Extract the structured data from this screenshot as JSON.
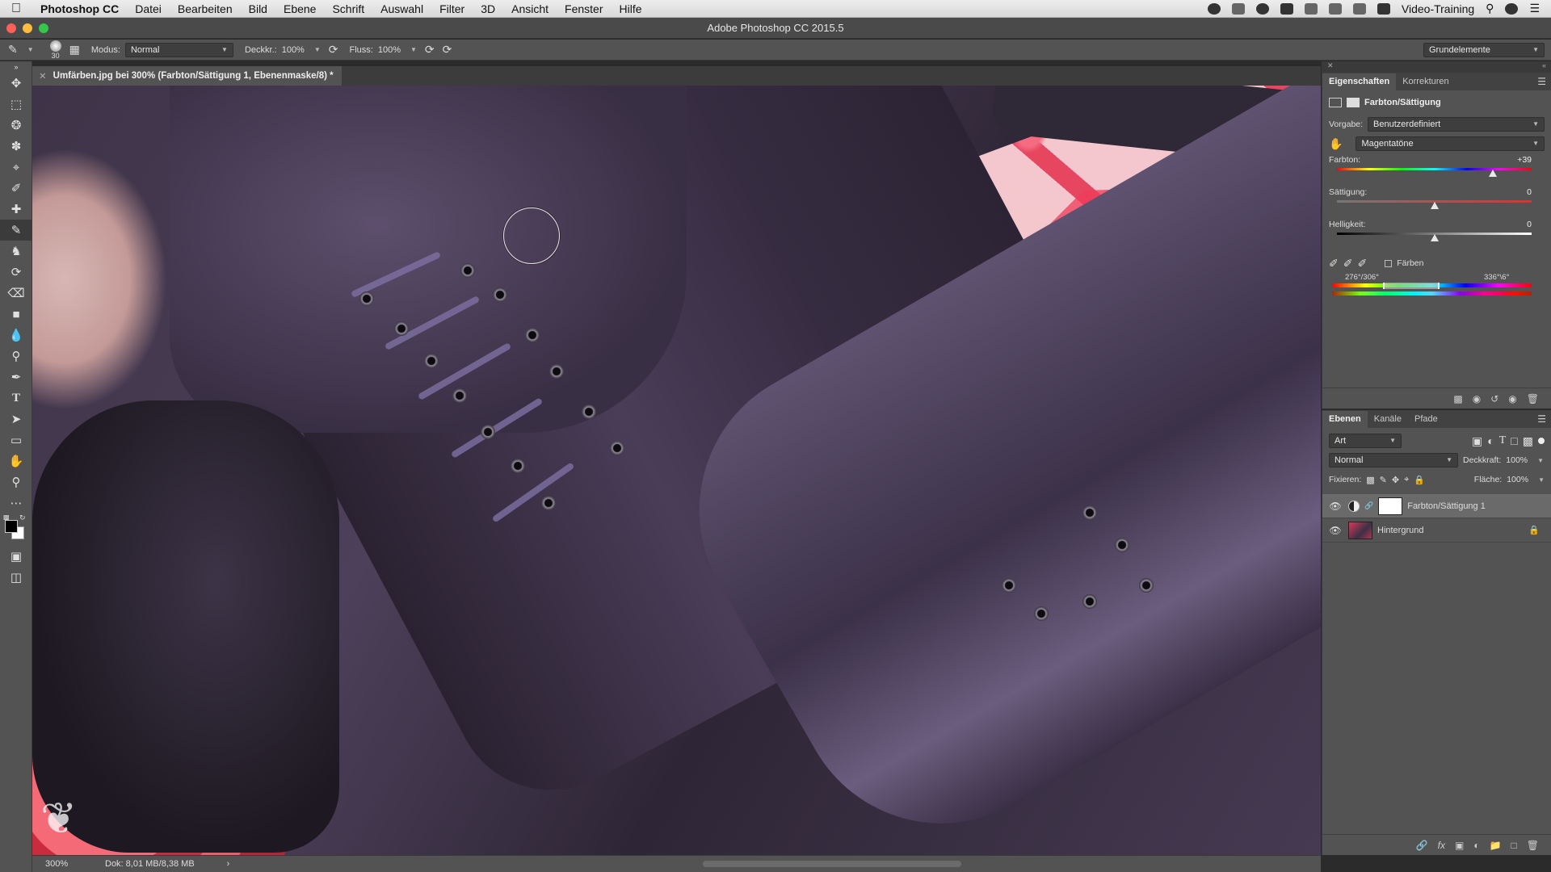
{
  "menubar": {
    "app_name": "Photoshop CC",
    "items": [
      "Datei",
      "Bearbeiten",
      "Bild",
      "Ebene",
      "Schrift",
      "Auswahl",
      "Filter",
      "3D",
      "Ansicht",
      "Fenster",
      "Hilfe"
    ],
    "right_label": "Video-Training"
  },
  "window": {
    "title": "Adobe Photoshop CC 2015.5"
  },
  "options": {
    "brush_size": "30",
    "modus_label": "Modus:",
    "modus_value": "Normal",
    "deckkraft_label": "Deckkr.:",
    "deckkraft_value": "100%",
    "fluss_label": "Fluss:",
    "fluss_value": "100%",
    "workspace": "Grundelemente"
  },
  "document": {
    "tab_title": "Umfärben.jpg bei 300% (Farbton/Sättigung 1, Ebenenmaske/8) *"
  },
  "status": {
    "zoom": "300%",
    "doc_info": "Dok: 8,01 MB/8,38 MB"
  },
  "properties": {
    "tabs": [
      "Eigenschaften",
      "Korrekturen"
    ],
    "adjustment_name": "Farbton/Sättigung",
    "vorgabe_label": "Vorgabe:",
    "vorgabe_value": "Benutzerdefiniert",
    "range_value": "Magentatöne",
    "farbton_label": "Farbton:",
    "farbton_value": "+39",
    "farbton_level": 0.8,
    "saettigung_label": "Sättigung:",
    "saettigung_value": "0",
    "saettigung_level": 0.5,
    "helligkeit_label": "Helligkeit:",
    "helligkeit_value": "0",
    "helligkeit_level": 0.5,
    "faerben_label": "Färben",
    "range_left": "276°/306°",
    "range_right": "336°\\6°"
  },
  "layers": {
    "tabs": [
      "Ebenen",
      "Kanäle",
      "Pfade"
    ],
    "filter_label": "Art",
    "blend_mode": "Normal",
    "deckkraft_label": "Deckkraft:",
    "deckkraft_value": "100%",
    "fixieren_label": "Fixieren:",
    "flaeche_label": "Fläche:",
    "flaeche_value": "100%",
    "items": [
      {
        "name": "Farbton/Sättigung 1",
        "selected": true
      },
      {
        "name": "Hintergrund",
        "selected": false
      }
    ]
  },
  "colors": {
    "accent": "#535353",
    "canvas_red": "#f24863",
    "leather": "#4a3d58"
  }
}
